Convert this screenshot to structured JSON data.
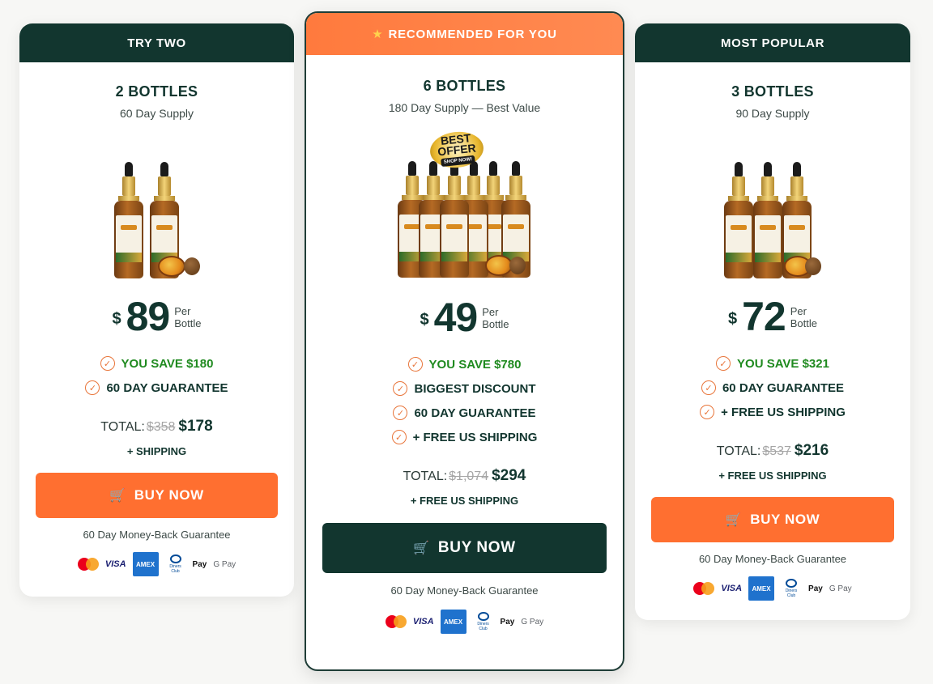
{
  "plans": {
    "left": {
      "header": "TRY TWO",
      "title": "2 BOTTLES",
      "supply": "60 Day Supply",
      "currency": "$",
      "price": "89",
      "per_line1": "Per",
      "per_line2": "Bottle",
      "features": [
        "YOU SAVE $180",
        "60 DAY GUARANTEE"
      ],
      "total_label": "TOTAL:",
      "total_old": "$358",
      "total_new": "$178",
      "shipping": "+ SHIPPING",
      "buy_label": "BUY NOW",
      "guarantee": "60 Day Money-Back Guarantee"
    },
    "center": {
      "header": "RECOMMENDED FOR YOU",
      "title": "6 BOTTLES",
      "supply": "180 Day Supply — Best Value",
      "badge_line1": "BEST",
      "badge_line2": "OFFER",
      "badge_line3": "SHOP NOW!",
      "currency": "$",
      "price": "49",
      "per_line1": "Per",
      "per_line2": "Bottle",
      "features": [
        "YOU SAVE $780",
        "BIGGEST DISCOUNT",
        "60 DAY GUARANTEE",
        "+ FREE US SHIPPING"
      ],
      "total_label": "TOTAL:",
      "total_old": "$1,074",
      "total_new": "$294",
      "shipping": "+ FREE US SHIPPING",
      "buy_label": "BUY NOW",
      "guarantee": "60 Day Money-Back Guarantee"
    },
    "right": {
      "header": "MOST POPULAR",
      "title": "3 BOTTLES",
      "supply": "90 Day Supply",
      "currency": "$",
      "price": "72",
      "per_line1": "Per",
      "per_line2": "Bottle",
      "features": [
        "YOU SAVE $321",
        "60 DAY GUARANTEE",
        "+ FREE US SHIPPING"
      ],
      "total_label": "TOTAL:",
      "total_old": "$537",
      "total_new": "$216",
      "shipping": "+ FREE US SHIPPING",
      "buy_label": "BUY NOW",
      "guarantee": "60 Day Money-Back Guarantee"
    }
  },
  "payments": {
    "visa": "VISA",
    "amex": "AMEX",
    "diners": "Diners Club",
    "apple_pay": "Pay",
    "google_pay": "G Pay"
  },
  "icons": {
    "star": "star-icon",
    "check": "check-circle-icon",
    "cart": "cart-icon"
  },
  "colors": {
    "dark_green": "#12362f",
    "orange": "#ff6f30",
    "save_green": "#1f8a1f",
    "check_orange": "#e8753a"
  }
}
